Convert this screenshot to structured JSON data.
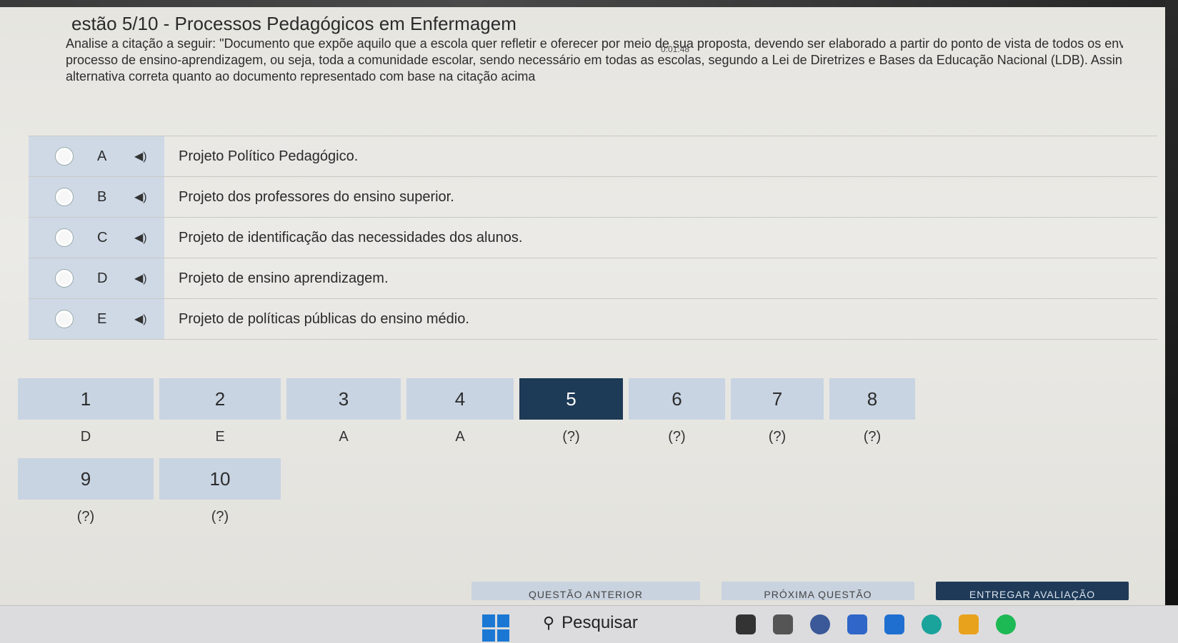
{
  "header": {
    "title": "estão 5/10 - Processos Pedagógicos em Enfermagem",
    "timer": "0:01:48"
  },
  "question": {
    "lines": [
      "Analise a citação a seguir: \"Documento que expõe aquilo que a escola quer refletir e oferecer por meio de sua proposta, devendo ser elaborado a partir do ponto de vista de todos os envolvidos no",
      "processo de ensino-aprendizagem, ou seja, toda a comunidade escolar, sendo necessário em todas as escolas, segundo a Lei de Diretrizes e Bases da Educação Nacional (LDB). Assinale a",
      "alternativa correta quanto ao documento representado com base na citação acima"
    ]
  },
  "options": [
    {
      "letter": "A",
      "text": "Projeto Político Pedagógico."
    },
    {
      "letter": "B",
      "text": "Projeto dos professores do ensino superior."
    },
    {
      "letter": "C",
      "text": "Projeto de identificação das necessidades dos alunos."
    },
    {
      "letter": "D",
      "text": "Projeto de ensino aprendizagem."
    },
    {
      "letter": "E",
      "text": "Projeto de políticas públicas do ensino médio."
    }
  ],
  "navigation": {
    "row1": [
      {
        "num": "1",
        "answer": "D"
      },
      {
        "num": "2",
        "answer": "E"
      },
      {
        "num": "3",
        "answer": "A"
      },
      {
        "num": "4",
        "answer": "A"
      },
      {
        "num": "5",
        "answer": "(?)"
      },
      {
        "num": "6",
        "answer": "(?)"
      },
      {
        "num": "7",
        "answer": "(?)"
      },
      {
        "num": "8",
        "answer": "(?)"
      }
    ],
    "row2": [
      {
        "num": "9",
        "answer": "(?)"
      },
      {
        "num": "10",
        "answer": "(?)"
      }
    ],
    "active": "5"
  },
  "footer": {
    "prev": "QUESTÃO ANTERIOR",
    "next": "PRÓXIMA QUESTÃO",
    "submit": "ENTREGAR AVALIAÇÃO"
  },
  "taskbar": {
    "search_label": "Pesquisar"
  },
  "colors": {
    "accent_dark": "#1d3a56",
    "nav_cell": "#c8d4e2",
    "option_left": "#cfd9e6"
  }
}
